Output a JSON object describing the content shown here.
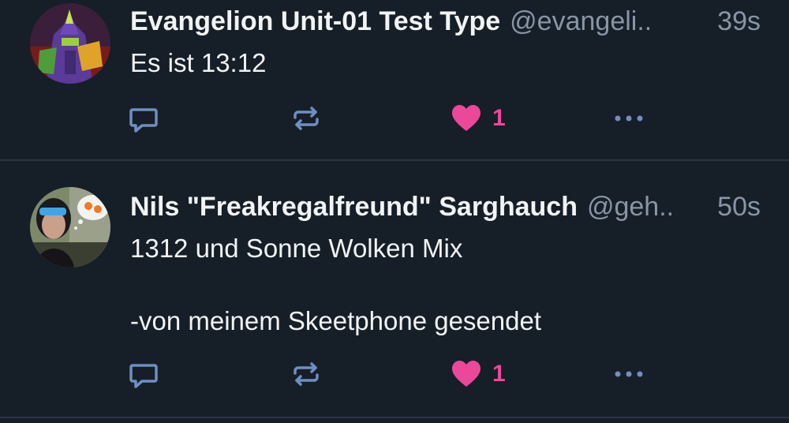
{
  "posts": [
    {
      "display_name": "Evangelion Unit-01 Test Type",
      "handle": "@evangeli..",
      "time": "39s",
      "text": "Es ist 13:12",
      "like_count": "1",
      "liked": true
    },
    {
      "display_name": "Nils \"Freakregalfreund\" Sarghauch",
      "handle": "@geh..",
      "time": "50s",
      "text": "1312 und Sonne Wolken Mix\n\n-von meinem Skeetphone gesendet",
      "like_count": "1",
      "liked": true
    }
  ],
  "icons": {
    "reply": "reply-icon",
    "repost": "repost-icon",
    "like": "heart-icon",
    "more": "more-icon"
  },
  "colors": {
    "background": "#161e27",
    "text": "#f1f3f5",
    "muted": "#8795a6",
    "icon": "#6f8fc1",
    "like": "#ec4899",
    "divider": "#2a3542"
  }
}
